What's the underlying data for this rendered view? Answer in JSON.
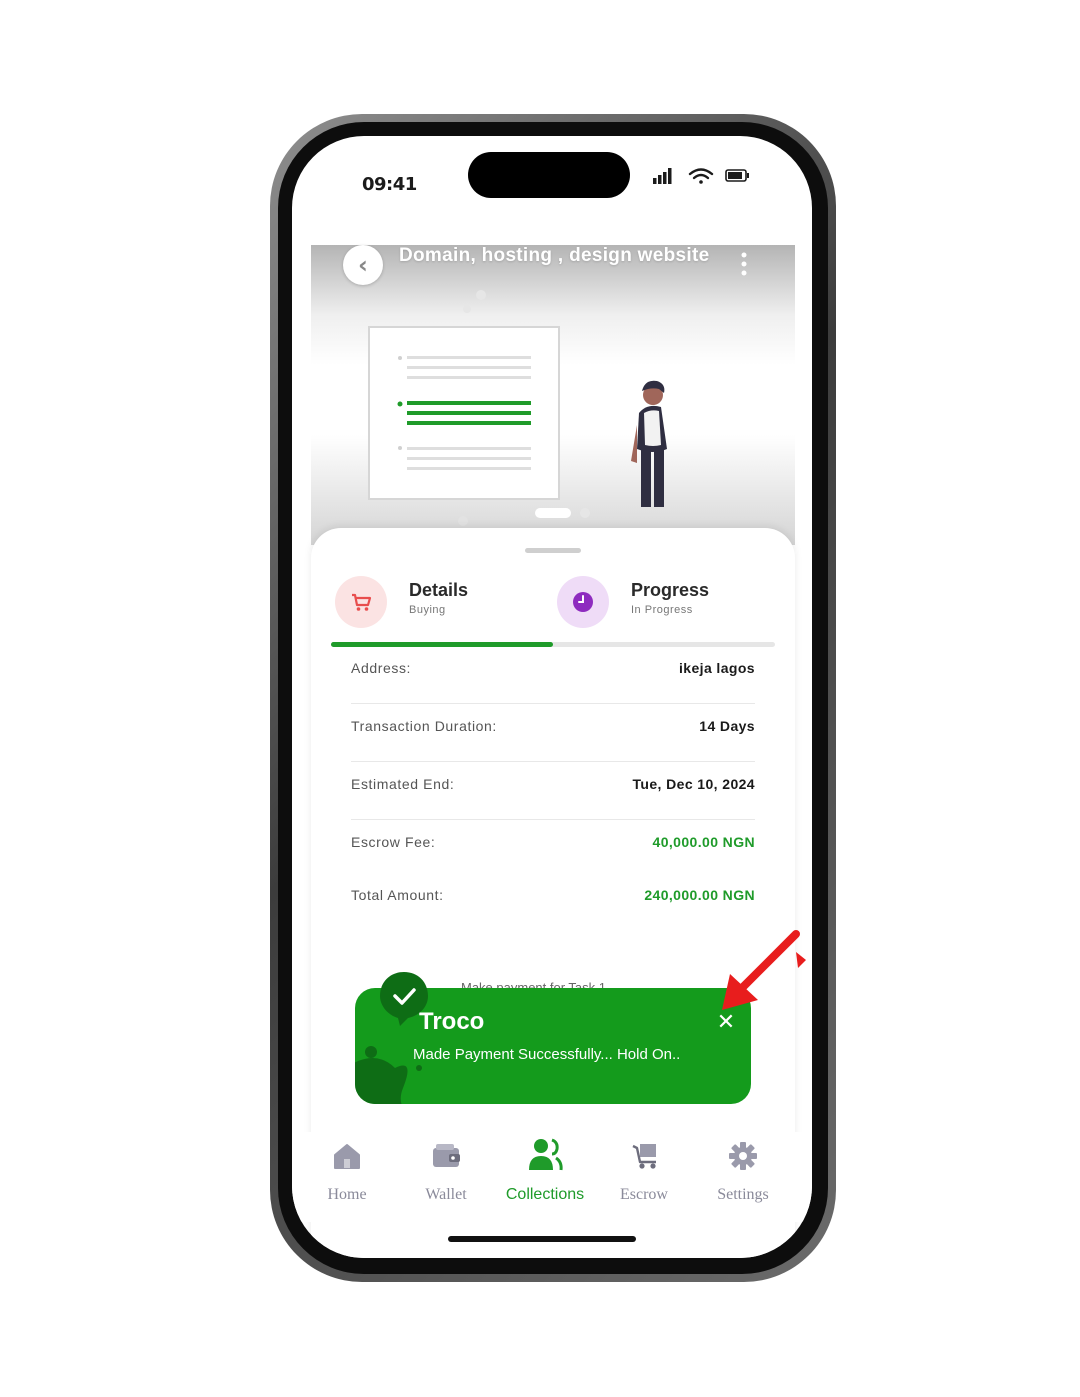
{
  "status_bar": {
    "time": "09:41"
  },
  "header": {
    "title": "Domain, hosting , design website"
  },
  "tabs": [
    {
      "title": "Details",
      "subtitle": "Buying",
      "icon": "cart-icon",
      "color": "#e84d4d"
    },
    {
      "title": "Progress",
      "subtitle": "In Progress",
      "icon": "clock-icon",
      "color": "#8e2bbf"
    }
  ],
  "tab_progress": 0.5,
  "details": {
    "rows": [
      {
        "label": "Address:",
        "value": "ikeja  lagos"
      },
      {
        "label": "Transaction Duration:",
        "value": "14 Days"
      },
      {
        "label": "Estimated End:",
        "value": "Tue, Dec 10, 2024"
      },
      {
        "label": "Escrow Fee:",
        "value": "40,000.00 NGN"
      },
      {
        "label": "Total Amount:",
        "value": "240,000.00 NGN"
      }
    ],
    "obscured_text": "Make payment for Task 1"
  },
  "toast": {
    "title": "Troco",
    "message": "Made Payment Successfully... Hold On..",
    "close_label": "✕"
  },
  "nav": {
    "items": [
      {
        "label": "Home",
        "icon": "home-icon",
        "active": false
      },
      {
        "label": "Wallet",
        "icon": "wallet-icon",
        "active": false
      },
      {
        "label": "Collections",
        "icon": "collections-icon",
        "active": true
      },
      {
        "label": "Escrow",
        "icon": "escrow-icon",
        "active": false
      },
      {
        "label": "Settings",
        "icon": "settings-icon",
        "active": false
      }
    ]
  },
  "colors": {
    "accent": "#1f9b2a",
    "toast": "#149b1c",
    "annotation": "#e81d1d",
    "inactive": "#8a8a9a"
  }
}
